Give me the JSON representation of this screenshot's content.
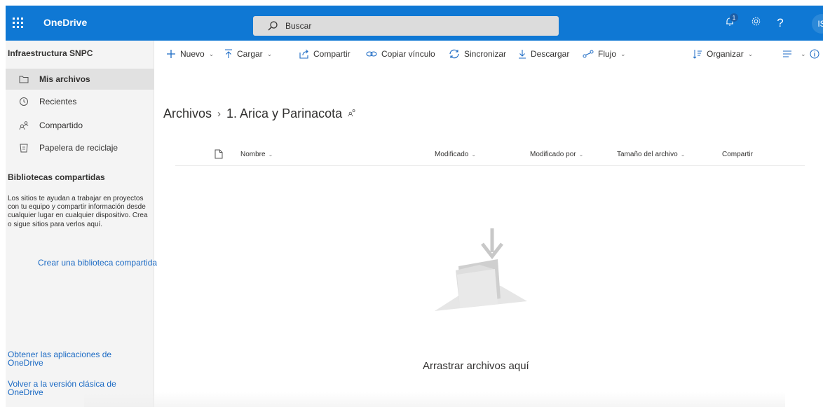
{
  "app": {
    "name": "OneDrive",
    "brand_color": "#0f78d4"
  },
  "search": {
    "label": "Buscar"
  },
  "topbar": {
    "notifications_count": "1",
    "settings_icon": "gear-icon",
    "help_icon": "?",
    "avatar_initials": "IS"
  },
  "nav": {
    "site_title": "Infraestructura SNPC",
    "items": [
      {
        "label": "Mis archivos",
        "icon": "folder-icon",
        "active": true
      },
      {
        "label": "Recientes",
        "icon": "clock-icon"
      },
      {
        "label": "Compartido",
        "icon": "people-icon"
      },
      {
        "label": "Papelera de reciclaje",
        "icon": "recycle-bin-icon"
      }
    ],
    "shared_title": "Bibliotecas compartidas",
    "shared_desc": "Los sitios te ayudan a trabajar en proyectos con tu equipo y compartir información desde cualquier lugar en cualquier dispositivo. Crea o sigue sitios para verlos aquí.",
    "create_library": "Crear una biblioteca compartida",
    "get_apps": "Obtener las aplicaciones de OneDrive",
    "classic": "Volver a la versión clásica de OneDrive"
  },
  "commands": {
    "new": "Nuevo",
    "upload": "Cargar",
    "share": "Compartir",
    "copy_link": "Copiar vínculo",
    "sync": "Sincronizar",
    "download": "Descargar",
    "flow": "Flujo",
    "sort": "Organizar"
  },
  "breadcrumb": {
    "root": "Archivos",
    "current": "1. Arica y Parinacota"
  },
  "columns": {
    "name": "Nombre",
    "modified": "Modificado",
    "modified_by": "Modificado por",
    "size": "Tamaño del archivo",
    "sharing": "Compartir"
  },
  "empty_state": {
    "text": "Arrastrar archivos aquí"
  },
  "colors": {
    "accent": "#0f78d4",
    "link": "#1b6ac4"
  }
}
